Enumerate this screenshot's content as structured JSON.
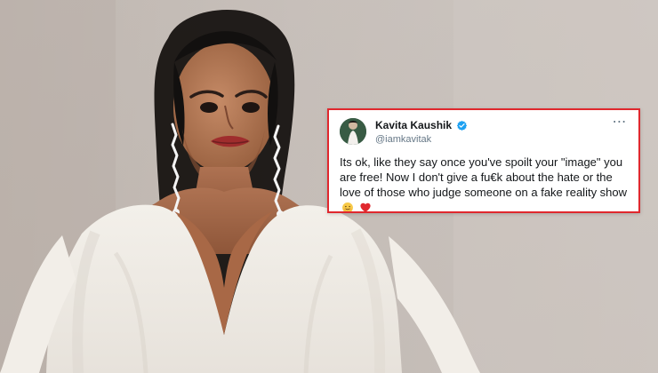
{
  "tweet": {
    "display_name": "Kavita Kaushik",
    "handle": "@iamkavitak",
    "text": "Its ok, like they say once you've spoilt your \"image\" you are free! Now I don't give a fu€k about the hate or the love of those who judge someone on a fake reality show",
    "more_icon": "⋯",
    "verified_icon": "verified-badge-icon",
    "emoji": [
      "hugging-face-emoji",
      "red-heart-emoji"
    ]
  },
  "colors": {
    "tweet_border": "#e0282e",
    "verified_blue": "#1da1f2",
    "photo_background": "#c9c0b9"
  }
}
